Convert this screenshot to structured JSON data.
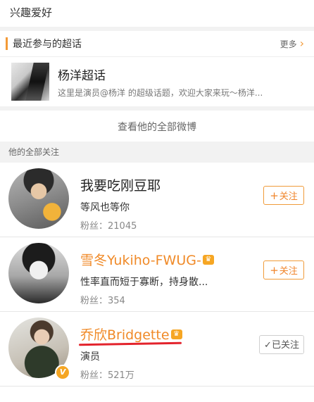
{
  "hobby_section": {
    "title": "兴趣爱好"
  },
  "recent_supertopics": {
    "title": "最近参与的超话",
    "more_label": "更多",
    "more_icon": "chevron-right",
    "topic": {
      "name": "杨洋超话",
      "description": "这里是演员@杨洋 的超级话题，欢迎大家来玩～杨洋..."
    }
  },
  "view_all_posts": "查看他的全部微博",
  "following_section": {
    "label": "他的全部关注"
  },
  "users": [
    {
      "name": "我要吃刚豆耶",
      "desc": "等风也等你",
      "fans_label": "粉丝：",
      "fans": "21045",
      "button": "关注",
      "button_icon": "+"
    },
    {
      "name": "雪冬Yukiho-FWUG-",
      "desc": "性率直而短于寡断，持身散...",
      "fans_label": "粉丝：",
      "fans": "354",
      "button": "关注",
      "button_icon": "+"
    },
    {
      "name": "乔欣Bridgette",
      "desc": "演员",
      "fans_label": "粉丝：",
      "fans": "521万",
      "button": "已关注",
      "button_icon": "✓"
    }
  ],
  "colors": {
    "accent": "#f08a28",
    "underline": "#e3232c",
    "background_gray": "#f2f2f2"
  }
}
